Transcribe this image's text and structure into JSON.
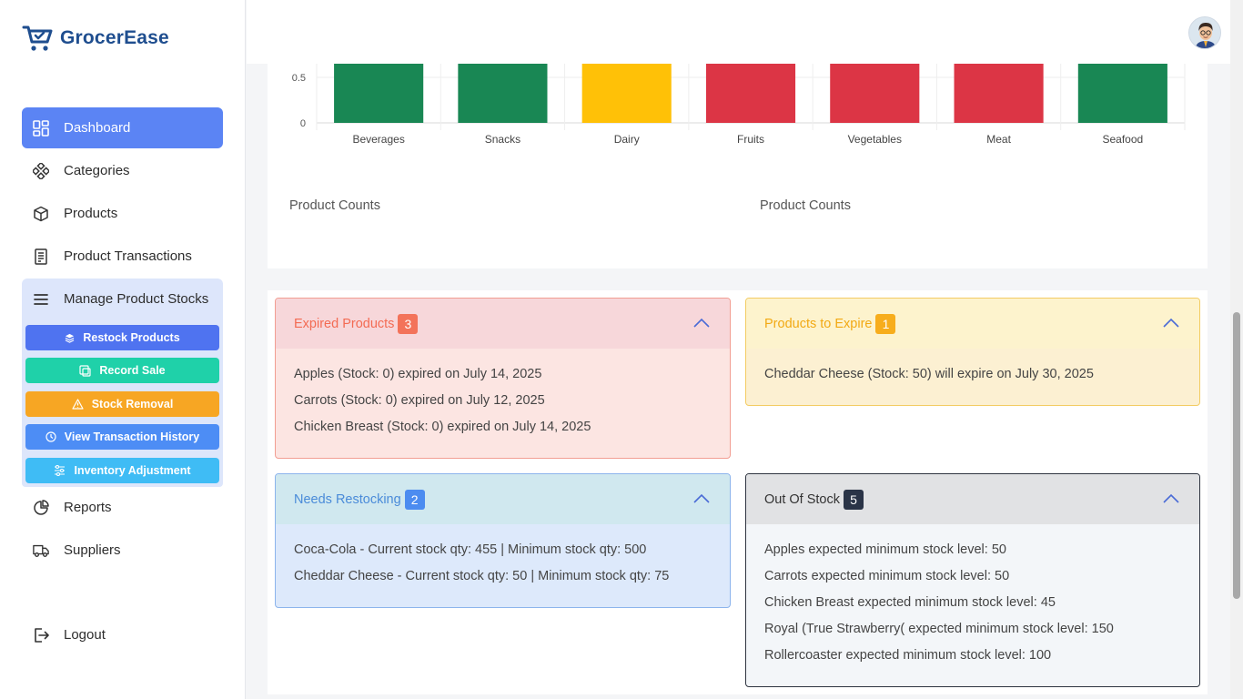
{
  "app": {
    "name": "GrocerEase"
  },
  "sidebar": {
    "items": [
      {
        "label": "Dashboard"
      },
      {
        "label": "Categories"
      },
      {
        "label": "Products"
      },
      {
        "label": "Product Transactions"
      },
      {
        "label": "Manage Product Stocks"
      },
      {
        "label": "Reports"
      },
      {
        "label": "Suppliers"
      },
      {
        "label": "Logout"
      }
    ],
    "submenu": [
      {
        "label": "Restock Products",
        "color": "#4f73f0"
      },
      {
        "label": "Record Sale",
        "color": "#1fd1a9"
      },
      {
        "label": "Stock Removal",
        "color": "#f7a623"
      },
      {
        "label": "View Transaction History",
        "color": "#4d8df5"
      },
      {
        "label": "Inventory Adjustment",
        "color": "#3fbcf5"
      }
    ]
  },
  "chart_data": {
    "type": "bar",
    "categories": [
      "Beverages",
      "Snacks",
      "Dairy",
      "Fruits",
      "Vegetables",
      "Meat",
      "Seafood"
    ],
    "bar_colors": [
      "#198754",
      "#198754",
      "#ffc107",
      "#dc3545",
      "#dc3545",
      "#dc3545",
      "#198754"
    ],
    "y_ticks": [
      "0.5",
      "0"
    ],
    "captions": [
      "Product Counts",
      "Product Counts"
    ]
  },
  "alerts": {
    "expired": {
      "title": "Expired Products",
      "count": "3",
      "colors": {
        "bg": "#fce5e2",
        "head": "#f7d7da",
        "border": "#f29d92",
        "title": "#f36b53",
        "badge": "#f3735a"
      },
      "lines": [
        "Apples (Stock: 0) expired on July 14, 2025",
        "Carrots (Stock: 0) expired on July 12, 2025",
        "Chicken Breast (Stock: 0) expired on July 14, 2025"
      ]
    },
    "to_expire": {
      "title": "Products to Expire",
      "count": "1",
      "colors": {
        "bg": "#fcf0d2",
        "head": "#fdf3cd",
        "border": "#f3cc63",
        "title": "#f2a913",
        "badge": "#f7ad1c"
      },
      "lines": [
        "Cheddar Cheese (Stock: 50) will expire on July 30, 2025"
      ]
    },
    "restock": {
      "title": "Needs Restocking",
      "count": "2",
      "colors": {
        "bg": "#dde9fb",
        "head": "#d0e8ef",
        "border": "#8cb4ec",
        "title": "#4a8bd9",
        "badge": "#4c8cf0"
      },
      "lines": [
        "Coca-Cola - Current stock qty: 455 | Minimum stock qty: 500",
        "Cheddar Cheese - Current stock qty: 50 | Minimum stock qty: 75"
      ]
    },
    "out_of_stock": {
      "title": "Out Of Stock",
      "count": "5",
      "colors": {
        "bg": "#f3f6f9",
        "head": "#e1e2e4",
        "border": "#2e3440",
        "title": "#333333",
        "badge": "#2a3447"
      },
      "lines": [
        "Apples expected minimum stock level: 50",
        "Carrots expected minimum stock level: 50",
        "Chicken Breast expected minimum stock level: 45",
        "Royal (True Strawberry( expected minimum stock level: 150",
        "Rollercoaster expected minimum stock level: 100"
      ]
    }
  }
}
